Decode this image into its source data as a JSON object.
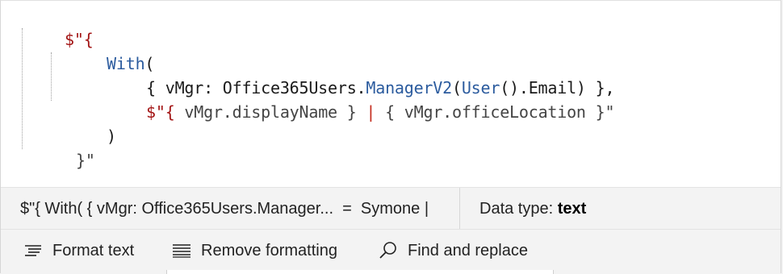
{
  "code": {
    "line1": {
      "open": "$\"{"
    },
    "line2": {
      "fn": "With",
      "paren": "("
    },
    "line3": {
      "open": "{ vMgr: Office365Users.",
      "fn1": "ManagerV2",
      "paren1": "(",
      "fn2": "User",
      "rest": "().Email) },"
    },
    "line4": {
      "interp_open": "$\"{ ",
      "expr1": "vMgr.displayName",
      "mid1": " } ",
      "sep": "|",
      "mid2": " { ",
      "expr2": "vMgr.officeLocation",
      "close": " }\""
    },
    "line5": {
      "paren": ")"
    },
    "line6": {
      "close": "}\""
    }
  },
  "result": {
    "preview": "$\"{ With( { vMgr: Office365Users.Manager...  =  Symone |",
    "datatype_label": "Data type: ",
    "datatype_value": "text"
  },
  "toolbar": {
    "format_label": "Format text",
    "remove_label": "Remove formatting",
    "find_label": "Find and replace"
  },
  "icons": {
    "format": "format-text-icon",
    "remove": "remove-formatting-icon",
    "find": "search-icon"
  }
}
